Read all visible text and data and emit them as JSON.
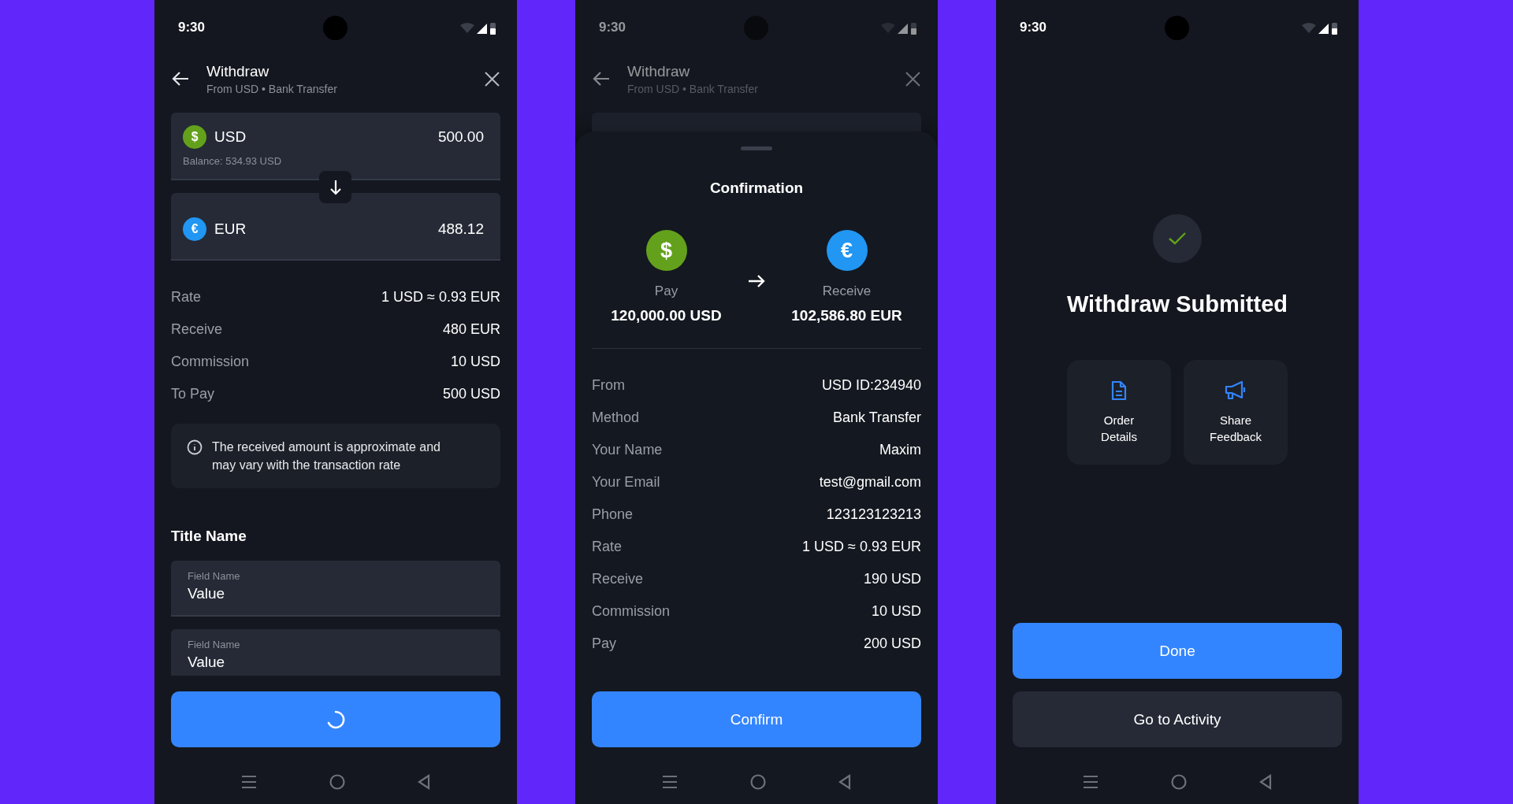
{
  "screens": [
    {
      "kind": "form",
      "status_bar": {
        "time": "9:30"
      },
      "header": {
        "title": "Withdraw",
        "subtitle": "From USD • Bank Transfer"
      },
      "from": {
        "currency": "USD",
        "symbol": "$",
        "color": "#63a11c",
        "amount": "500.00",
        "balance": "Balance: 534.93 USD"
      },
      "to": {
        "currency": "EUR",
        "symbol": "€",
        "color": "#2196f3",
        "amount": "488.12"
      },
      "summary": [
        {
          "label": "Rate",
          "value": "1 USD ≈ 0.93 EUR"
        },
        {
          "label": "Receive",
          "value": "480 EUR"
        },
        {
          "label": "Commission",
          "value": "10 USD"
        },
        {
          "label": "To Pay",
          "value": "500 USD"
        }
      ],
      "notice": "The received amount is approximate and may vary with the transaction rate",
      "section_title": "Title Name",
      "fields": [
        {
          "label": "Field Name",
          "value": "Value"
        },
        {
          "label": "Field Name",
          "value": "Value"
        }
      ],
      "submit": {
        "loading": true
      }
    },
    {
      "kind": "confirmation",
      "status_bar": {
        "time": "9:30"
      },
      "header": {
        "title": "Withdraw",
        "subtitle": "From USD • Bank Transfer"
      },
      "sheet": {
        "title": "Confirmation",
        "pay": {
          "label": "Pay",
          "symbol": "$",
          "color": "#63a11c",
          "amount": "120,000.00 USD"
        },
        "receive": {
          "label": "Receive",
          "symbol": "€",
          "color": "#2196f3",
          "amount": "102,586.80 EUR"
        },
        "details": [
          {
            "label": "From",
            "value": "USD ID:234940"
          },
          {
            "label": "Method",
            "value": "Bank Transfer"
          },
          {
            "label": "Your Name",
            "value": "Maxim"
          },
          {
            "label": "Your Email",
            "value": "test@gmail.com"
          },
          {
            "label": "Phone",
            "value": "123123123213"
          },
          {
            "label": "Rate",
            "value": "1 USD ≈ 0.93 EUR"
          },
          {
            "label": "Receive",
            "value": "190 USD"
          },
          {
            "label": "Commission",
            "value": "10 USD"
          },
          {
            "label": "Pay",
            "value": "200 USD"
          }
        ],
        "button": "Confirm"
      }
    },
    {
      "kind": "success",
      "status_bar": {
        "time": "9:30"
      },
      "title": "Withdraw Submitted",
      "actions": [
        {
          "kind": "document",
          "label": "Order\nDetails"
        },
        {
          "kind": "megaphone",
          "label": "Share\nFeedback"
        }
      ],
      "buttons": [
        {
          "kind": "primary",
          "label": "Done"
        },
        {
          "kind": "secondary",
          "label": "Go to Activity"
        }
      ]
    }
  ]
}
